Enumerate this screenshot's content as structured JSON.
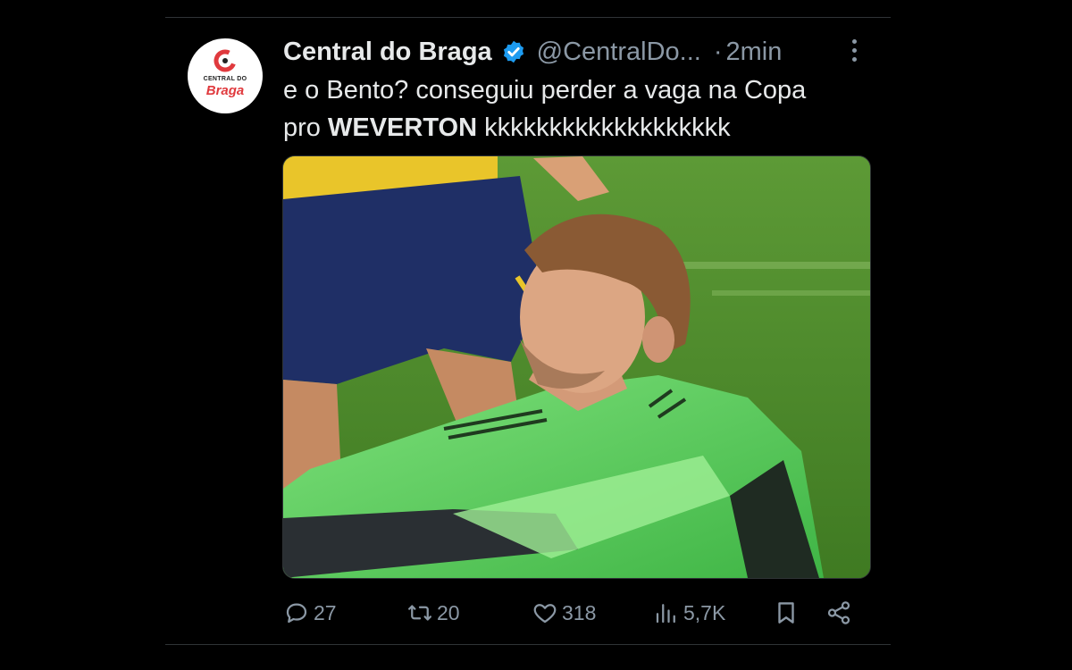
{
  "tweet": {
    "author": {
      "name": "Central do Braga",
      "handle": "@CentralDo...",
      "avatar_line1": "CENTRAL DO",
      "avatar_line2": "Braga",
      "verified": true
    },
    "time_separator": "·",
    "time": "2min",
    "text_line1": "e o Bento? conseguiu perder a vaga na Copa",
    "text_line2_pre": "pro ",
    "text_line2_bold": "WEVERTON",
    "text_line2_post": " kkkkkkkkkkkkkkkkkkk",
    "media": {
      "description": "photo"
    },
    "metrics": {
      "replies": "27",
      "retweets": "20",
      "likes": "318",
      "views": "5,7K"
    }
  },
  "colors": {
    "background": "#000000",
    "text": "#e7e9ea",
    "secondary": "#8b98a5",
    "verified": "#1d9bf0",
    "brand_red": "#e03a3e"
  },
  "icons": [
    "verified-badge-icon",
    "more-icon",
    "reply-icon",
    "retweet-icon",
    "like-icon",
    "views-icon",
    "bookmark-icon",
    "share-icon"
  ]
}
